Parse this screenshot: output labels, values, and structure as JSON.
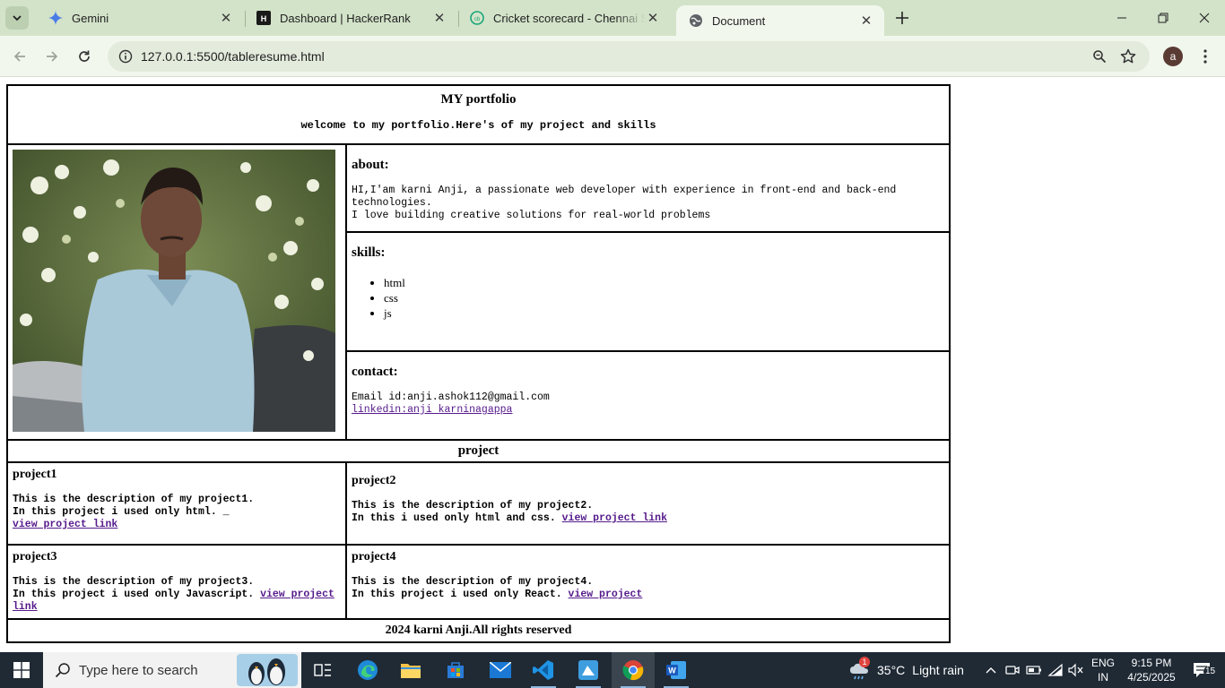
{
  "browser": {
    "tabs": [
      {
        "title": "Gemini",
        "favicon": "gemini-sparkle-icon",
        "active": false
      },
      {
        "title": "Dashboard | HackerRank",
        "favicon": "hackerrank-icon",
        "active": false
      },
      {
        "title": "Cricket scorecard - Chennai Super Kings",
        "favicon": "cricbuzz-icon",
        "active": false
      },
      {
        "title": "Document",
        "favicon": "globe-icon",
        "active": true
      }
    ],
    "url": "127.0.0.1:5500/tableresume.html",
    "profile_initial": "a",
    "colors": {
      "tabbar": "#d3e3c9",
      "toolbar": "#f2f7ee",
      "omnibox": "#e3ebdc"
    }
  },
  "page": {
    "title": "MY portfolio",
    "subtitle": "welcome to my portfolio.Here's of my project and skills",
    "about": {
      "heading": "about:",
      "line1": "HI,I'am karni Anji, a passionate web developer with experience in front-end and back-end technologies.",
      "line2": "I love building creative solutions for real-world problems"
    },
    "skills": {
      "heading": "skills:",
      "items": [
        "html",
        "css",
        "js"
      ]
    },
    "contact": {
      "heading": "contact:",
      "email": "Email id:anji.ashok112@gmail.com",
      "linkedin": "linkedin:anji karninagappa"
    },
    "project_heading": "project",
    "projects": [
      {
        "title": "project1",
        "line1": "This is the description of my project1.",
        "line2": "In this project i used only html. _",
        "link": "view project link"
      },
      {
        "title": "project2",
        "line1": "This is the description of my project2.",
        "line2": "In this i used only html and css.",
        "link": "view project link"
      },
      {
        "title": "project3",
        "line1": "This is the description of my project3.",
        "line2": "In this project i used only Javascript.",
        "link": "view project link"
      },
      {
        "title": "project4",
        "line1": "This is the description of my project4.",
        "line2": "In this project i used only React.",
        "link": "view project"
      }
    ],
    "footer": "2024 karni Anji.All rights reserved"
  },
  "taskbar": {
    "search_placeholder": "Type here to search",
    "apps": [
      "task-view-icon",
      "edge-icon",
      "file-explorer-icon",
      "microsoft-store-icon",
      "mail-icon",
      "vscode-icon",
      "paint-icon",
      "chrome-icon",
      "word-icon"
    ],
    "weather_temp": "35°C",
    "weather_desc": "Light rain",
    "weather_badge": "1",
    "lang_line1": "ENG",
    "lang_line2": "IN",
    "time": "9:15 PM",
    "date": "4/25/2025",
    "notifications": "15"
  }
}
